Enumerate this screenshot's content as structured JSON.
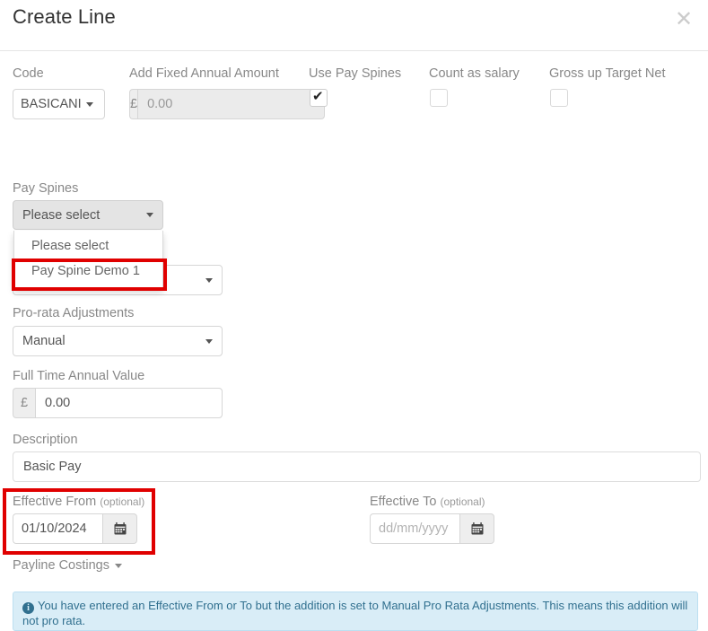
{
  "modal": {
    "title": "Create Line",
    "close_icon": "close-icon"
  },
  "form": {
    "code": {
      "label": "Code",
      "value": "BASICANI",
      "caret_icon": "chevron-down-icon"
    },
    "fixed_annual_amount": {
      "label": "Add Fixed Annual Amount",
      "currency_symbol": "£",
      "value": "0.00"
    },
    "use_pay_spines": {
      "label": "Use Pay Spines",
      "checked": true,
      "check_glyph": "✔"
    },
    "count_as_salary": {
      "label": "Count as salary",
      "checked": false
    },
    "gross_up_target_net": {
      "label": "Gross up Target Net",
      "checked": false
    },
    "pay_spines": {
      "label": "Pay Spines",
      "selected": "Please select",
      "options": [
        "Please select",
        "Pay Spine Demo 1"
      ],
      "highlighted_option": "Pay Spine Demo 1"
    },
    "pro_rata_adjustments": {
      "label": "Pro-rata Adjustments",
      "value": "Manual"
    },
    "full_time_annual_value": {
      "label": "Full Time Annual Value",
      "currency_symbol": "£",
      "value": "0.00"
    },
    "description": {
      "label": "Description",
      "value": "Basic Pay"
    },
    "effective_from": {
      "label": "Effective From",
      "optional_tag": "(optional)",
      "value": "01/10/2024",
      "calendar_icon": "calendar-icon"
    },
    "effective_to": {
      "label": "Effective To",
      "optional_tag": "(optional)",
      "value": "",
      "placeholder": "dd/mm/yyyy",
      "calendar_icon": "calendar-icon"
    },
    "payline_costings": {
      "label": "Payline Costings"
    }
  },
  "alert": {
    "icon": "info-icon",
    "message": "You have entered an Effective From or To but the addition is set to Manual Pro Rata Adjustments. This means this addition will not pro rata."
  },
  "colors": {
    "highlight": "#e00000",
    "alert_bg": "#d9edf7",
    "alert_border": "#bcdff1",
    "alert_text": "#31708f"
  }
}
